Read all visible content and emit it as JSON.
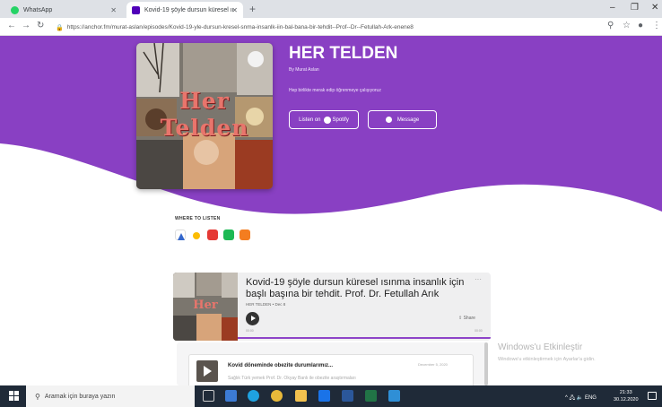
{
  "colors": {
    "brand": "#8940c3",
    "tab_bar": "#dee1e6",
    "taskbar": "#1f2a38"
  },
  "browser": {
    "tabs": [
      {
        "label": "WhatsApp",
        "icon": "whatsapp-icon"
      },
      {
        "label": "Kovid-19 şöyle dursun küresel ıı",
        "icon": "anchor-icon"
      }
    ],
    "new_tab": "+",
    "url": "https://anchor.fm/murat-aslan/episodes/Kovid-19-yle-dursun-kresel-snma-insanlk-iin-bal-bana-bir-tehdit--Prof--Dr--Fetullah-Ark-enene8"
  },
  "podcast": {
    "cover_line1": "Her",
    "cover_line2": "Telden",
    "title": "HER TELDEN",
    "author": "By Murat Aslan",
    "description": "Hep birlikte merak edip öğrenmeye çalışıyoruz",
    "listen_button": "Listen on",
    "spotify_label": "Spotify",
    "message_button": "Message",
    "where_to_listen": "WHERE TO LISTEN",
    "platforms": [
      "apple-podcasts-icon",
      "google-podcasts-icon",
      "pocket-casts-icon",
      "spotify-icon",
      "rss-icon"
    ]
  },
  "episode": {
    "title": "Kovid-19 şöyle dursun küresel ısınma insanlık için başlı başına bir tehdit. Prof. Dr. Fetullah Arık",
    "meta": "HER TELDEN • Dec 8",
    "share": "Share",
    "time_start": "00:00",
    "time_end": "00:00",
    "more": "···"
  },
  "episode_list": [
    {
      "title": "Kovid döneminde obezite durumlarımız...",
      "date": "December 5, 2020",
      "description": "Sağlık Türk yemek Prof. Dr. Okyay Banlı ile obezite araştırmaları"
    }
  ],
  "watermark": {
    "line1": "Windows'u Etkinleştir",
    "line2": "Windows'u etkinleştirmek için Ayarlar'a gidin."
  },
  "taskbar": {
    "search_placeholder": "Aramak için buraya yazın",
    "tray_text": "^ 🖧 🔈 ENG",
    "time": "21:33",
    "date": "30.12.2020"
  }
}
